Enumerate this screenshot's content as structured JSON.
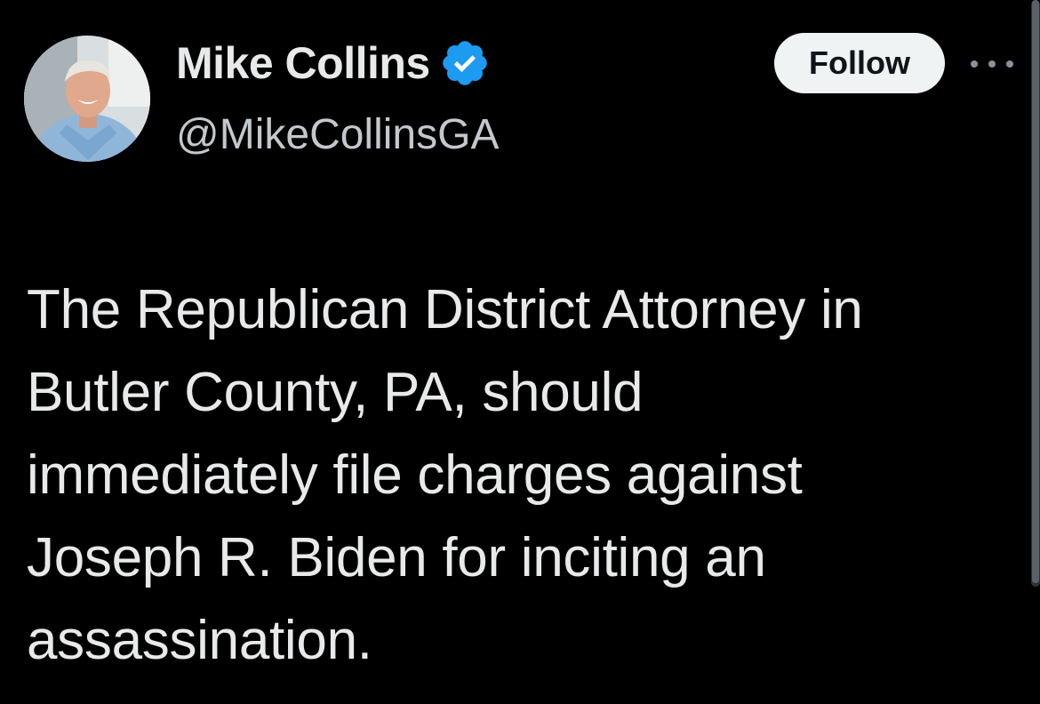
{
  "author": {
    "display_name": "Mike Collins",
    "handle": "@MikeCollinsGA",
    "verified": true,
    "verified_color": "#1d9bf0"
  },
  "actions": {
    "follow_label": "Follow",
    "more_icon": "more-horizontal-icon"
  },
  "tweet": {
    "lines": [
      "The Republican District Attorney in",
      "Butler County, PA, should",
      "immediately file charges against",
      "Joseph R. Biden for inciting an",
      "assassination."
    ]
  },
  "colors": {
    "background": "#000000",
    "text": "#e7e9ea",
    "handle": "#c4c8cc",
    "follow_bg": "#eff3f4",
    "follow_text": "#0f1419"
  }
}
